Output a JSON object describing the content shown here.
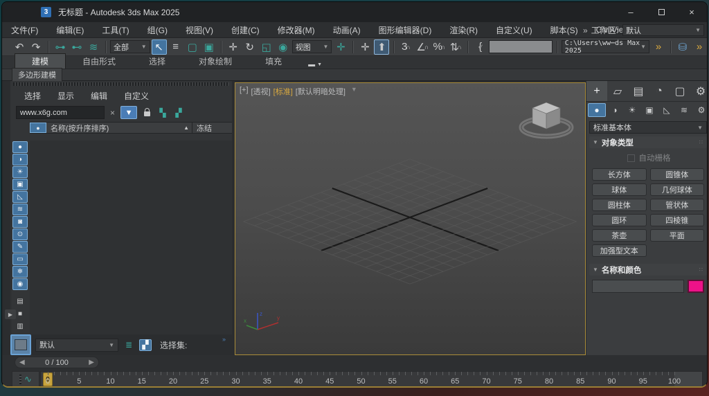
{
  "title_bar": {
    "app_icon": "3",
    "title": "无标题 - Autodesk 3ds Max 2025"
  },
  "menu_bar": {
    "items": [
      "文件(F)",
      "编辑(E)",
      "工具(T)",
      "组(G)",
      "视图(V)",
      "创建(C)",
      "修改器(M)",
      "动画(A)",
      "图形编辑器(D)",
      "渲染(R)",
      "自定义(U)",
      "脚本(S)",
      "CivilView"
    ],
    "overflow": "»",
    "workspace_label": "工作区:",
    "workspace_value": "默认"
  },
  "toolbar": {
    "selection_filter_value": "全部",
    "coord_system_value": "视图",
    "project_path_value": "C:\\Users\\ww⋯ds Max 2025",
    "overflow": "»",
    "overflow2": "»"
  },
  "ribbon": {
    "tabs": [
      "建模",
      "自由形式",
      "选择",
      "对象绘制",
      "填充"
    ],
    "active_tab": "建模",
    "panel_tab": "多边形建模"
  },
  "scene_explorer": {
    "menus": [
      "选择",
      "显示",
      "编辑",
      "自定义"
    ],
    "search_value": "www.x6g.com",
    "clear_glyph": "×",
    "name_column": "名称(按升序排序)",
    "sort_indicator": "▲",
    "frozen_column": "冻结"
  },
  "viewport": {
    "label_general": "[+]",
    "label_pov": "[透视]",
    "label_renderer": "[标准]",
    "label_shading": "[默认明暗处理]"
  },
  "command_panel": {
    "category_value": "标准基本体",
    "object_type_title": "对象类型",
    "autogrid_label": "自动栅格",
    "primitive_buttons": [
      "长方体",
      "圆锥体",
      "球体",
      "几何球体",
      "圆柱体",
      "管状体",
      "圆环",
      "四棱锥",
      "茶壶",
      "平面",
      "加强型文本"
    ],
    "name_color_title": "名称和颜色",
    "object_name_value": "",
    "swatch_color": "#ee1289"
  },
  "bottom_bar": {
    "preset_value": "默认",
    "selection_set_label": "选择集:",
    "overflow": "»"
  },
  "frame_display": {
    "value": "0 / 100"
  },
  "timeline": {
    "start": 0,
    "end": 100,
    "label_step": 5,
    "playhead_label": "0",
    "labels": [
      0,
      5,
      10,
      15,
      20,
      25,
      30,
      35,
      40,
      45,
      50,
      55,
      60,
      65,
      70,
      75,
      80,
      85,
      90,
      95,
      100
    ]
  },
  "colors": {
    "accent_blue": "#44749f",
    "viewport_border": "#ab8d39",
    "swatch": "#ee1289",
    "teal": "#3aa79c",
    "playhead_gold": "#c8a43e"
  }
}
